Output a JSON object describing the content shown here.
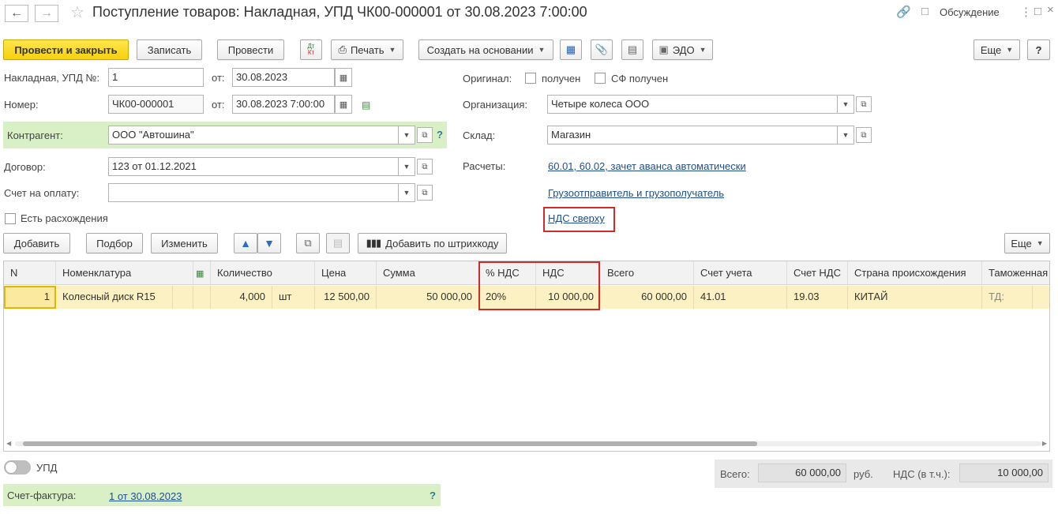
{
  "window": {
    "title": "Поступление товаров: Накладная, УПД ЧК00-000001 от 30.08.2023 7:00:00",
    "discuss_label": "Обсуждение"
  },
  "toolbar": {
    "post_close": "Провести и закрыть",
    "save": "Записать",
    "post": "Провести",
    "print": "Печать",
    "create_based": "Создать на основании",
    "edo": "ЭДО",
    "more": "Еще",
    "help": "?"
  },
  "form": {
    "invoice_label": "Накладная, УПД №:",
    "invoice_value": "1",
    "from1_label": "от:",
    "from1_value": "30.08.2023",
    "number_label": "Номер:",
    "number_value": "ЧК00-000001",
    "from2_label": "от:",
    "from2_value": "30.08.2023  7:00:00",
    "counterparty_label": "Контрагент:",
    "counterparty_value": "ООО \"Автошина\"",
    "counterparty_help": "?",
    "contract_label": "Договор:",
    "contract_value": "123 от 01.12.2021",
    "payment_label": "Счет на оплату:",
    "payment_value": "",
    "discrepancy_label": "Есть расхождения",
    "original_label": "Оригинал:",
    "received_label": "получен",
    "sf_received_label": "СФ получен",
    "org_label": "Организация:",
    "org_value": "Четыре колеса ООО",
    "warehouse_label": "Склад:",
    "warehouse_value": "Магазин",
    "settlements_label": "Расчеты:",
    "settlements_link": "60.01, 60.02, зачет аванса автоматически",
    "shipper_link": "Грузоотправитель и грузополучатель",
    "vat_link": "НДС сверху"
  },
  "table_toolbar": {
    "add": "Добавить",
    "pick": "Подбор",
    "edit": "Изменить",
    "barcode": "Добавить по штрихкоду",
    "more": "Еще"
  },
  "table": {
    "headers": [
      "N",
      "Номенклатура",
      "Количество",
      "Цена",
      "Сумма",
      "% НДС",
      "НДС",
      "Всего",
      "Счет учета",
      "Счет НДС",
      "Страна происхождения",
      "Таможенная"
    ],
    "rows": [
      {
        "n": "1",
        "item": "Колесный диск R15",
        "qty": "4,000",
        "unit": "шт",
        "price": "12 500,00",
        "sum": "50 000,00",
        "vat_rate": "20%",
        "vat": "10 000,00",
        "total": "60 000,00",
        "account": "41.01",
        "vat_account": "19.03",
        "country": "КИТАЙ",
        "customs": "ТД:"
      }
    ]
  },
  "footer": {
    "upd_label": "УПД",
    "invoice_label": "Счет-фактура:",
    "invoice_link": "1 от 30.08.2023",
    "invoice_help": "?",
    "total_label": "Всего:",
    "total_value": "60 000,00",
    "currency": "руб.",
    "vat_label": "НДС (в т.ч.):",
    "vat_value": "10 000,00"
  },
  "colors": {
    "primary_button": "#f5d10c",
    "highlight_red": "#d02a2a",
    "selected_row": "#fbf1c2",
    "green_band": "#d9efc6",
    "link": "#1f4f8f"
  }
}
